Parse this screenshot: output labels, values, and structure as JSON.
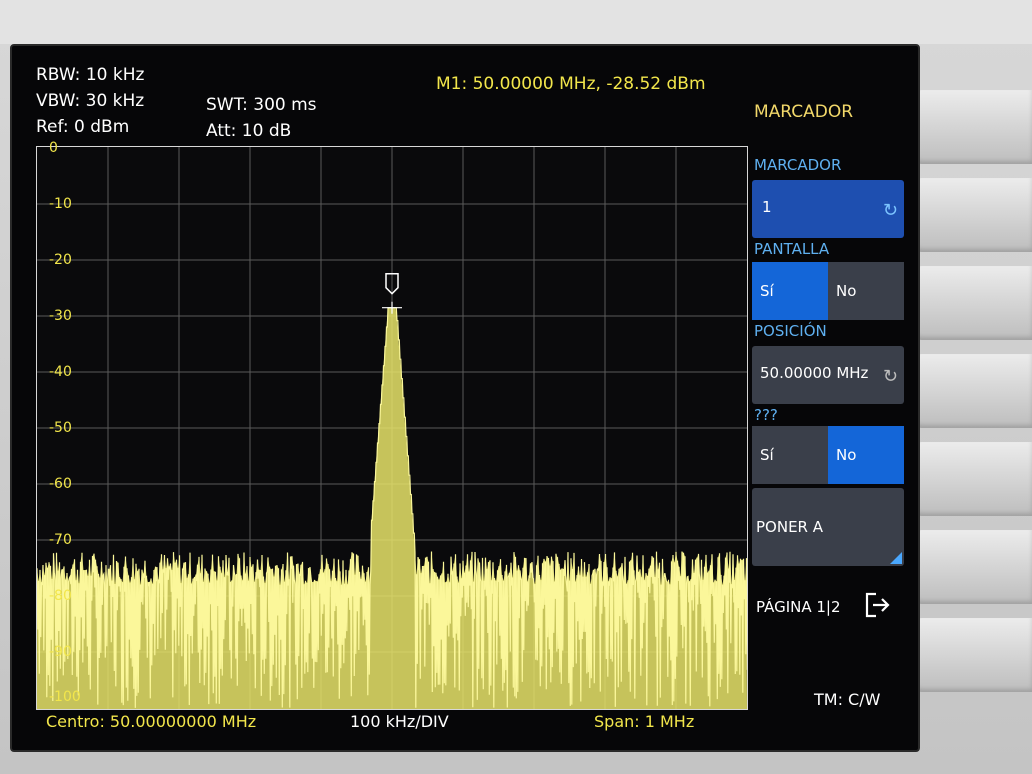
{
  "header": {
    "rbw": "RBW: 10 kHz",
    "vbw": "VBW: 30 kHz",
    "ref": "Ref: 0 dBm",
    "swt": "SWT: 300 ms",
    "att": "Att: 10 dB",
    "marker_readout": "M1: 50.00000 MHz, -28.52 dBm"
  },
  "menu": {
    "title": "MARCADOR",
    "marker_label": "MARCADOR",
    "marker_value": "1",
    "display_label": "PANTALLA",
    "display_yes": "Sí",
    "display_no": "No",
    "position_label": "POSICIÓN",
    "position_value": "50.00000 MHz",
    "unknown_label": "???",
    "unknown_yes": "Sí",
    "unknown_no": "No",
    "set_to": "PONER A",
    "page": "PÁGINA 1|2",
    "icons": [
      "cycle-icon",
      "cycle-icon",
      "exit-icon"
    ]
  },
  "footer": {
    "center": "Centro: 50.00000000 MHz",
    "div": "100 kHz/DIV",
    "span": "Span: 1 MHz",
    "mode": "TM: C/W"
  },
  "y_axis_labels": [
    "0",
    "-10",
    "-20",
    "-30",
    "-40",
    "-50",
    "-60",
    "-70",
    "-80",
    "-90",
    "-100"
  ],
  "chart_data": {
    "type": "line",
    "xlabel": "",
    "ylabel": "",
    "ylim": [
      -100,
      0
    ],
    "x_center_mhz": 50.0,
    "x_span_mhz": 1.0,
    "peak": {
      "x_mhz": 50.0,
      "y_dbm": -28.52
    },
    "noise_floor_dbm": -75,
    "grid": true,
    "trace_color": "#f4f27a"
  },
  "colors": {
    "yellow": "#f2e64b",
    "blue_label": "#5fb0f0",
    "selected": "#1466d8"
  }
}
